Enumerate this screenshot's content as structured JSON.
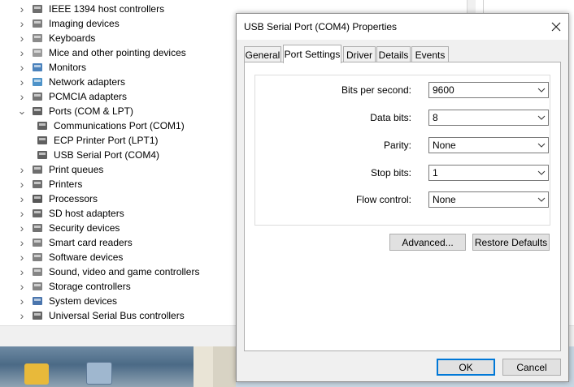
{
  "device_manager": {
    "tree": [
      {
        "label": "IEEE 1394 host controllers",
        "expanded": false,
        "indent": 0,
        "icon": "ieee1394-icon"
      },
      {
        "label": "Imaging devices",
        "expanded": false,
        "indent": 0,
        "icon": "camera-icon"
      },
      {
        "label": "Keyboards",
        "expanded": false,
        "indent": 0,
        "icon": "keyboard-icon"
      },
      {
        "label": "Mice and other pointing devices",
        "expanded": false,
        "indent": 0,
        "icon": "mouse-icon"
      },
      {
        "label": "Monitors",
        "expanded": false,
        "indent": 0,
        "icon": "monitor-icon"
      },
      {
        "label": "Network adapters",
        "expanded": false,
        "indent": 0,
        "icon": "network-icon"
      },
      {
        "label": "PCMCIA adapters",
        "expanded": false,
        "indent": 0,
        "icon": "pcmcia-icon"
      },
      {
        "label": "Ports (COM & LPT)",
        "expanded": true,
        "indent": 0,
        "icon": "port-icon"
      },
      {
        "label": "Communications Port (COM1)",
        "expanded": null,
        "indent": 1,
        "icon": "port-icon"
      },
      {
        "label": "ECP Printer Port (LPT1)",
        "expanded": null,
        "indent": 1,
        "icon": "port-icon"
      },
      {
        "label": "USB Serial Port (COM4)",
        "expanded": null,
        "indent": 1,
        "icon": "port-icon"
      },
      {
        "label": "Print queues",
        "expanded": false,
        "indent": 0,
        "icon": "printer-icon"
      },
      {
        "label": "Printers",
        "expanded": false,
        "indent": 0,
        "icon": "printer-icon"
      },
      {
        "label": "Processors",
        "expanded": false,
        "indent": 0,
        "icon": "processor-icon"
      },
      {
        "label": "SD host adapters",
        "expanded": false,
        "indent": 0,
        "icon": "sd-card-icon"
      },
      {
        "label": "Security devices",
        "expanded": false,
        "indent": 0,
        "icon": "security-icon"
      },
      {
        "label": "Smart card readers",
        "expanded": false,
        "indent": 0,
        "icon": "smart-card-icon"
      },
      {
        "label": "Software devices",
        "expanded": false,
        "indent": 0,
        "icon": "software-device-icon"
      },
      {
        "label": "Sound, video and game controllers",
        "expanded": false,
        "indent": 0,
        "icon": "speaker-icon"
      },
      {
        "label": "Storage controllers",
        "expanded": false,
        "indent": 0,
        "icon": "storage-icon"
      },
      {
        "label": "System devices",
        "expanded": false,
        "indent": 0,
        "icon": "system-icon"
      },
      {
        "label": "Universal Serial Bus controllers",
        "expanded": false,
        "indent": 0,
        "icon": "usb-icon"
      }
    ]
  },
  "dialog": {
    "title": "USB Serial Port (COM4) Properties",
    "tabs": [
      "General",
      "Port Settings",
      "Driver",
      "Details",
      "Events"
    ],
    "active_tab": "Port Settings",
    "fields": [
      {
        "label": "Bits per second:",
        "value": "9600"
      },
      {
        "label": "Data bits:",
        "value": "8"
      },
      {
        "label": "Parity:",
        "value": "None"
      },
      {
        "label": "Stop bits:",
        "value": "1"
      },
      {
        "label": "Flow control:",
        "value": "None"
      }
    ],
    "advanced_label": "Advanced...",
    "restore_label": "Restore Defaults",
    "ok_label": "OK",
    "cancel_label": "Cancel"
  },
  "colors": {
    "accent": "#0078d7",
    "dialog_bg": "#f0f0f0"
  }
}
